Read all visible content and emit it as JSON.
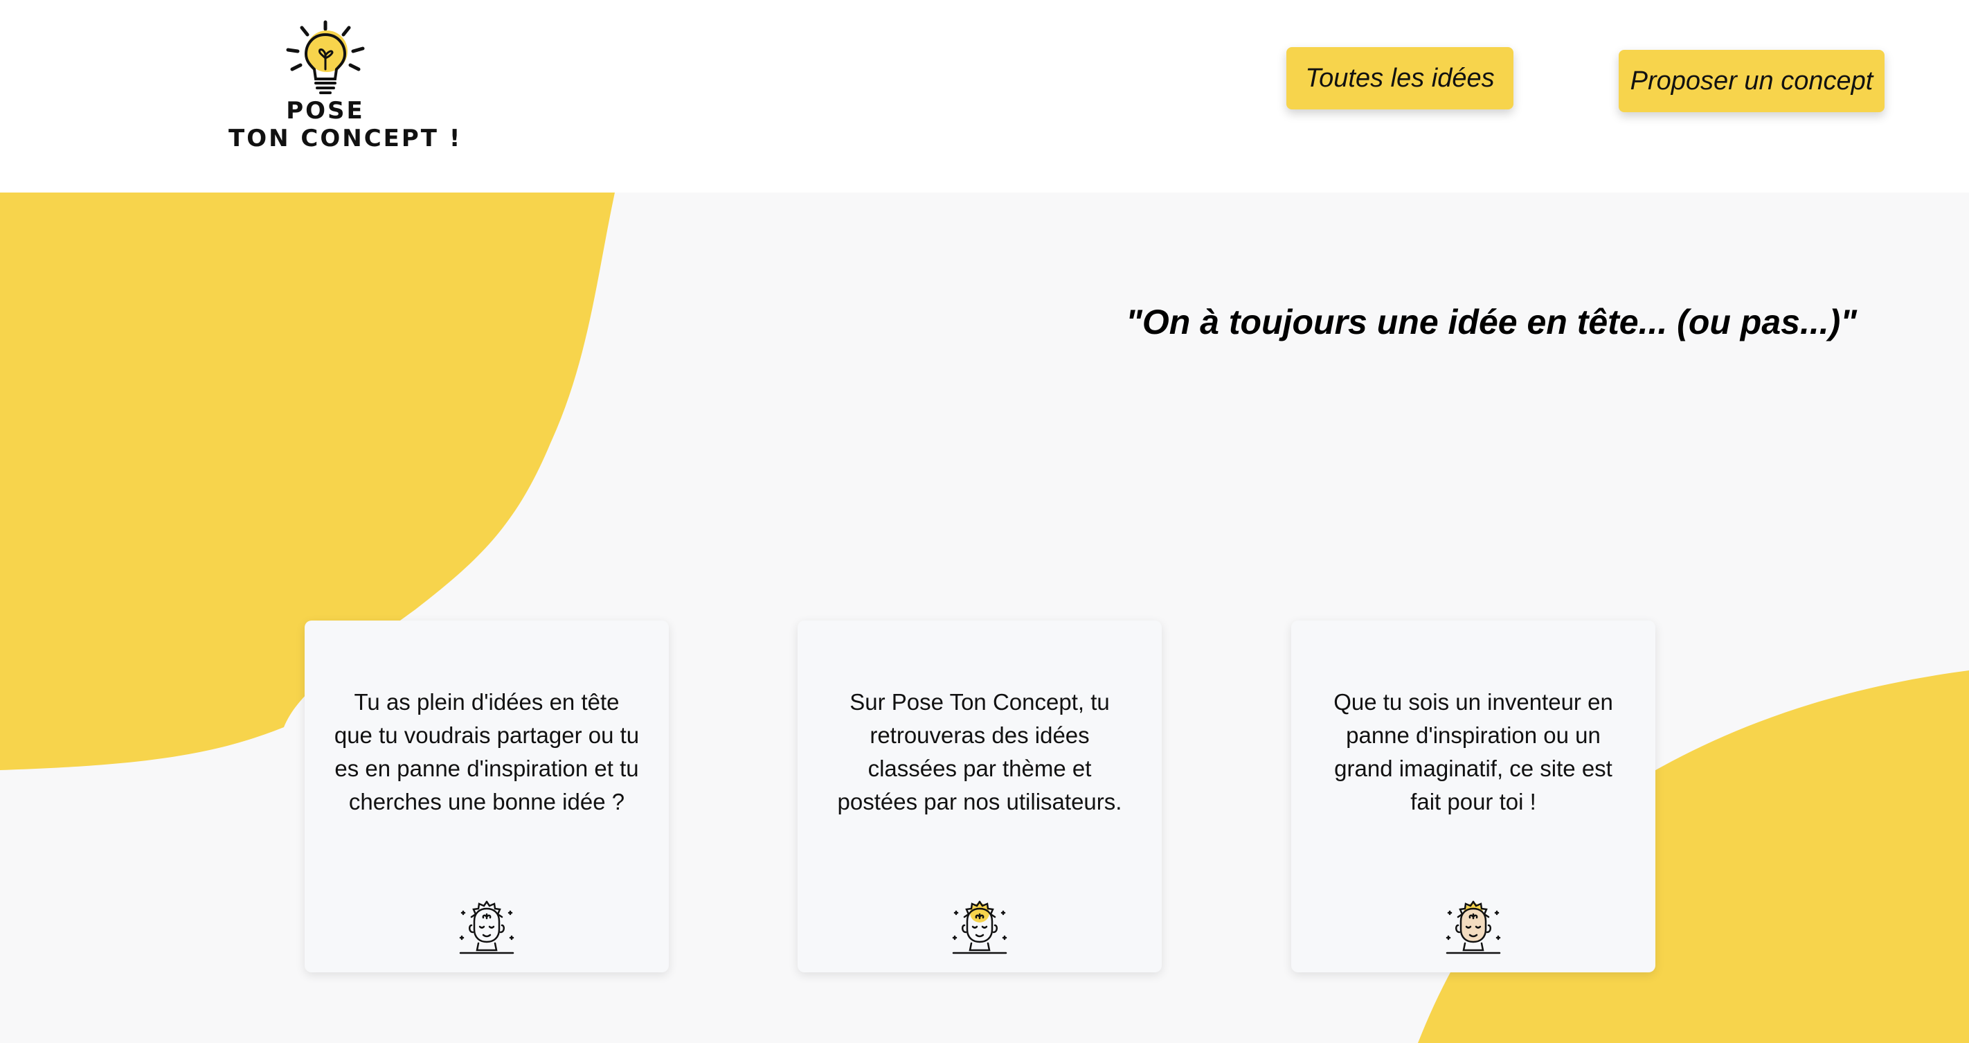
{
  "header": {
    "logo": {
      "line1": "POSE",
      "line2": "TON CONCEPT !",
      "icon": "lightbulb-icon"
    },
    "nav": {
      "all_ideas": "Toutes les idées",
      "propose": "Proposer un concept"
    }
  },
  "hero": {
    "tagline": "\"On à toujours une idée en tête... (ou pas...)\""
  },
  "cards": [
    {
      "text": "Tu as plein d'idées en tête que tu voudrais partager ou tu es en panne d'inspiration et tu cherches une bonne idée ?",
      "icon": "thinking-head-icon"
    },
    {
      "text": "Sur Pose Ton Concept, tu retrouveras des idées classées par thème et postées par nos utilisateurs.",
      "icon": "thinking-head-icon"
    },
    {
      "text": "Que tu sois un inventeur en panne d'inspiration ou un grand imaginatif, ce site est fait pour toi !",
      "icon": "thinking-head-icon"
    }
  ],
  "colors": {
    "accent": "#f7d44c",
    "background": "#f8f8f9",
    "header": "#ffffff"
  }
}
